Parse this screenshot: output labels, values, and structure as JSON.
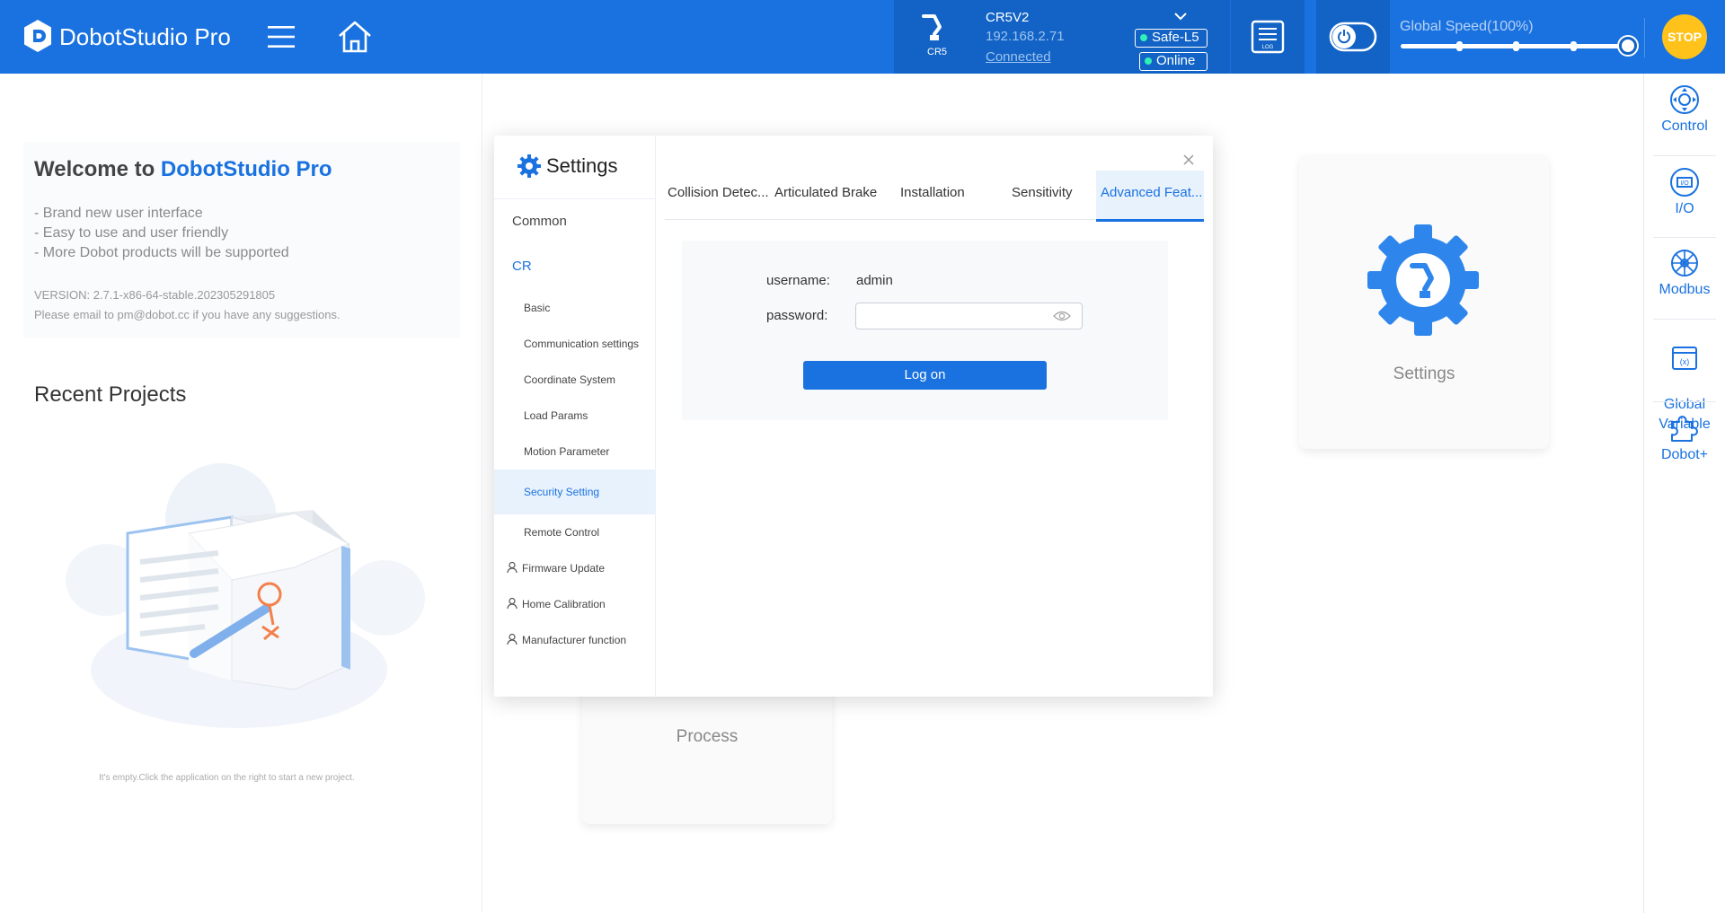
{
  "app": {
    "title": "DobotStudio Pro"
  },
  "robot": {
    "model_small": "CR5",
    "name": "CR5V2",
    "ip": "192.168.2.71",
    "connection": "Connected",
    "safety_badge": "Safe-L5",
    "status_badge": "Online"
  },
  "log_icon_label": "LOG",
  "speed": {
    "label": "Global Speed(100%)",
    "value_percent": 100
  },
  "stop_label": "STOP",
  "welcome": {
    "title_prefix": "Welcome to ",
    "title_brand": "DobotStudio Pro",
    "lines": [
      "- Brand new user interface",
      "- Easy to use and user friendly",
      "- More Dobot products will be supported"
    ],
    "version": "VERSION: 2.7.1-x86-64-stable.202305291805",
    "suggestion": "Please email to pm@dobot.cc if you have any suggestions."
  },
  "recent": {
    "title": "Recent Projects",
    "empty_text": "It's empty.Click the application on the right to start a new project."
  },
  "app_cards": {
    "settings": "Settings",
    "process": "Process"
  },
  "right_sidebar": {
    "items": [
      {
        "label": "Control",
        "icon": "control-icon"
      },
      {
        "label": "I/O",
        "icon": "io-icon"
      },
      {
        "label": "Modbus",
        "icon": "modbus-icon"
      },
      {
        "label": "Global\nVariable",
        "icon": "global-variable-icon"
      },
      {
        "label": "Dobot+",
        "icon": "puzzle-icon"
      }
    ]
  },
  "dialog": {
    "title": "Settings",
    "side": {
      "common": "Common",
      "cr": "CR",
      "items": [
        "Basic",
        "Communication settings",
        "Coordinate System",
        "Load Params",
        "Motion Parameter",
        "Security Setting",
        "Remote Control",
        "Firmware Update",
        "Home Calibration",
        "Manufacturer function"
      ],
      "active": "Security Setting"
    },
    "tabs": [
      "Collision Detec...",
      "Articulated Brake",
      "Installation",
      "Sensitivity",
      "Advanced Feat..."
    ],
    "active_tab": "Advanced Feat...",
    "login": {
      "username_label": "username:",
      "username_value": "admin",
      "password_label": "password:",
      "password_value": "",
      "button": "Log on"
    }
  },
  "colors": {
    "primary": "#1a72e0",
    "topbar_dark": "#1263c5",
    "stop": "#ffc21a",
    "status_dot": "#2ff0b8"
  }
}
